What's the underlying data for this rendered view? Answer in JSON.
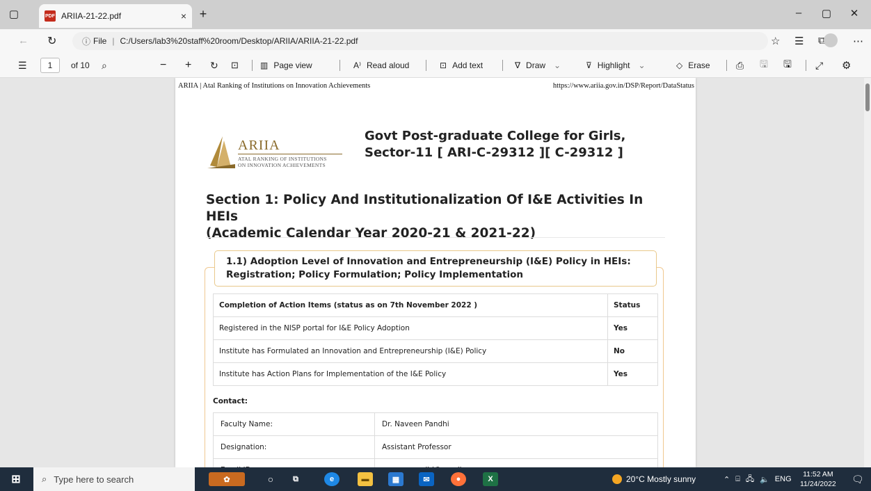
{
  "browser": {
    "tab_title": "ARIIA-21-22.pdf",
    "tab_close": "×",
    "new_tab": "+",
    "url_label": "File",
    "url": "C:/Users/lab3%20staff%20room/Desktop/ARIIA/ARIIA-21-22.pdf",
    "window_controls": {
      "minimize": "–",
      "restore": "▢",
      "close": "✕"
    }
  },
  "pdf_toolbar": {
    "page_number": "1",
    "page_total": "of 10",
    "page_view": "Page view",
    "read_aloud": "Read aloud",
    "add_text": "Add text",
    "draw": "Draw",
    "highlight": "Highlight",
    "erase": "Erase"
  },
  "document": {
    "header_left": "ARIIA | Atal Ranking of Institutions on Innovation Achievements",
    "header_right": "https://www.ariia.gov.in/DSP/Report/DataStatus",
    "logo_brand": "ARIIA",
    "logo_sub_line1": "ATAL RANKING OF INSTITUTIONS",
    "logo_sub_line2": "ON INNOVATION ACHIEVEMENTS",
    "college_line1": "Govt Post-graduate College for Girls,",
    "college_line2": "Sector-11 [ ARI-C-29312 ][ C-29312 ]",
    "section_line1": "Section 1: Policy And Institutionalization Of I&E Activities In HEIs",
    "section_line2": "(Academic Calendar Year 2020-21 & 2021-22)",
    "card_title_line1": "1.1) Adoption Level of Innovation and Entrepreneurship (I&E) Policy in HEIs:",
    "card_title_line2": "Registration; Policy Formulation; Policy Implementation",
    "status_table": {
      "header_item": "Completion of Action Items (status as on 7th November 2022 )",
      "header_status": "Status",
      "rows": [
        {
          "item": "Registered in the NISP portal for I&E Policy Adoption",
          "status": "Yes"
        },
        {
          "item": "Institute has Formulated an Innovation and Entrepreneurship (I&E) Policy",
          "status": "No"
        },
        {
          "item": "Institute has Action Plans for Implementation of the I&E Policy",
          "status": "Yes"
        }
      ]
    },
    "contact_label": "Contact:",
    "contact_rows": [
      {
        "key": "Faculty Name:",
        "value": "Dr. Naveen Pandhi"
      },
      {
        "key": "Designation:",
        "value": "Assistant Professor"
      },
      {
        "key": "Email ID:",
        "value": "naveenpandhi@gmail.com"
      }
    ]
  },
  "taskbar": {
    "search_placeholder": "Type here to search",
    "weather": "20°C  Mostly sunny",
    "language": "ENG",
    "time": "11:52 AM",
    "date": "11/24/2022"
  },
  "colors": {
    "accent_gold": "#8a6a2a",
    "card_border": "#f0c890",
    "taskbar": "#1f2d3d",
    "pdf_red": "#c42b1c"
  }
}
